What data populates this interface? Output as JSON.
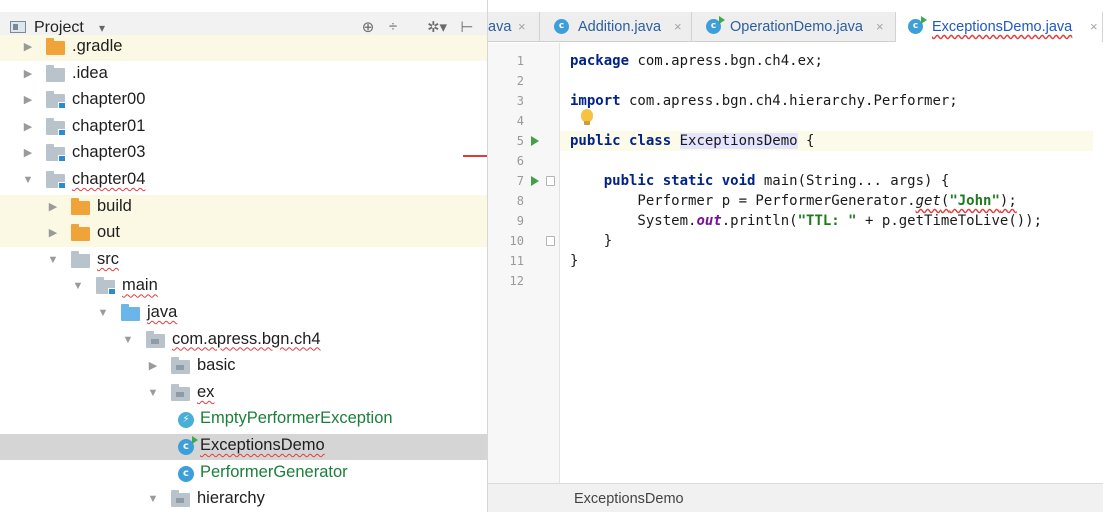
{
  "project_panel": {
    "title": "Project",
    "caret": "▾",
    "tools": [
      "⊕",
      "÷",
      "✲▾",
      "⊢"
    ]
  },
  "tree": [
    {
      "label": ".gradle",
      "depth": 0,
      "arrow": "▶",
      "icon": "orange-folder-icon",
      "highlight": true
    },
    {
      "label": ".idea",
      "depth": 0,
      "arrow": "▶",
      "icon": "gray-folder-icon"
    },
    {
      "label": "chapter00",
      "depth": 0,
      "arrow": "▶",
      "icon": "module-folder-icon"
    },
    {
      "label": "chapter01",
      "depth": 0,
      "arrow": "▶",
      "icon": "module-folder-icon"
    },
    {
      "label": "chapter03",
      "depth": 0,
      "arrow": "▶",
      "icon": "module-folder-icon"
    },
    {
      "label": "chapter04",
      "depth": 0,
      "arrow": "▼",
      "icon": "module-folder-icon",
      "wavy": true
    },
    {
      "label": "build",
      "depth": 1,
      "arrow": "▶",
      "icon": "orange-folder-icon",
      "highlight": true
    },
    {
      "label": "out",
      "depth": 1,
      "arrow": "▶",
      "icon": "orange-folder-icon",
      "highlight": true
    },
    {
      "label": "src",
      "depth": 1,
      "arrow": "▼",
      "icon": "gray-folder-icon",
      "wavy": true
    },
    {
      "label": "main",
      "depth": 2,
      "arrow": "▼",
      "icon": "module-folder-icon",
      "wavy": true
    },
    {
      "label": "java",
      "depth": 3,
      "arrow": "▼",
      "icon": "blue-folder-icon",
      "wavy": true
    },
    {
      "label": "com.apress.bgn.ch4",
      "depth": 4,
      "arrow": "▼",
      "icon": "package-icon",
      "wavy": true
    },
    {
      "label": "basic",
      "depth": 5,
      "arrow": "▶",
      "icon": "package-icon"
    },
    {
      "label": "ex",
      "depth": 5,
      "arrow": "▼",
      "icon": "package-icon",
      "wavy": true
    },
    {
      "label": "EmptyPerformerException",
      "depth": 6,
      "arrow": "",
      "icon": "exception-class-icon",
      "green": true
    },
    {
      "label": "ExceptionsDemo",
      "depth": 6,
      "arrow": "",
      "icon": "runnable-class-icon",
      "selected": true,
      "wavy": true
    },
    {
      "label": "PerformerGenerator",
      "depth": 6,
      "arrow": "",
      "icon": "class-icon",
      "green": true
    },
    {
      "label": "hierarchy",
      "depth": 5,
      "arrow": "▼",
      "icon": "package-icon"
    }
  ],
  "tabs": [
    {
      "label": "ava",
      "close": "×",
      "icon": ""
    },
    {
      "label": "Addition.java",
      "close": "×",
      "icon": "class-icon",
      "letter": "c"
    },
    {
      "label": "OperationDemo.java",
      "close": "×",
      "icon": "runnable-class-icon",
      "letter": "c"
    },
    {
      "label": "ExceptionsDemo.java",
      "close": "×",
      "icon": "runnable-class-icon",
      "letter": "c",
      "active": true
    }
  ],
  "editor": {
    "line_numbers": [
      "1",
      "2",
      "3",
      "4",
      "5",
      "6",
      "7",
      "8",
      "9",
      "10",
      "11",
      "12"
    ],
    "code": {
      "l1_kw": "package",
      "l1_rest": " com.apress.bgn.ch4.ex;",
      "l3_kw": "import",
      "l3_rest": " com.apress.bgn.ch4.hierarchy.Performer;",
      "l5_kw": "public class",
      "l5_sp": " ",
      "l5_cls": "ExceptionsDemo",
      "l5_rest": " {",
      "l7_indent": "    ",
      "l7_kw": "public static void",
      "l7_rest": " main(String... args) {",
      "l8_pre": "        Performer p = PerformerGenerator.",
      "l8_method": "get",
      "l8_paren": "(",
      "l8_str": "\"John\"",
      "l8_end": ");",
      "l9_pre": "        System.",
      "l9_field": "out",
      "l9_mid": ".println(",
      "l9_str": "\"TTL: \"",
      "l9_end": " + p.getTimeToLive());",
      "l10": "    }",
      "l11": "}"
    }
  },
  "breadcrumb": {
    "label": "ExceptionsDemo"
  },
  "colors": {
    "accent": "#1f57c3",
    "selection": "#d5d5d5",
    "highlight_row": "#fbf9e4",
    "green_text": "#1b7f3a"
  }
}
